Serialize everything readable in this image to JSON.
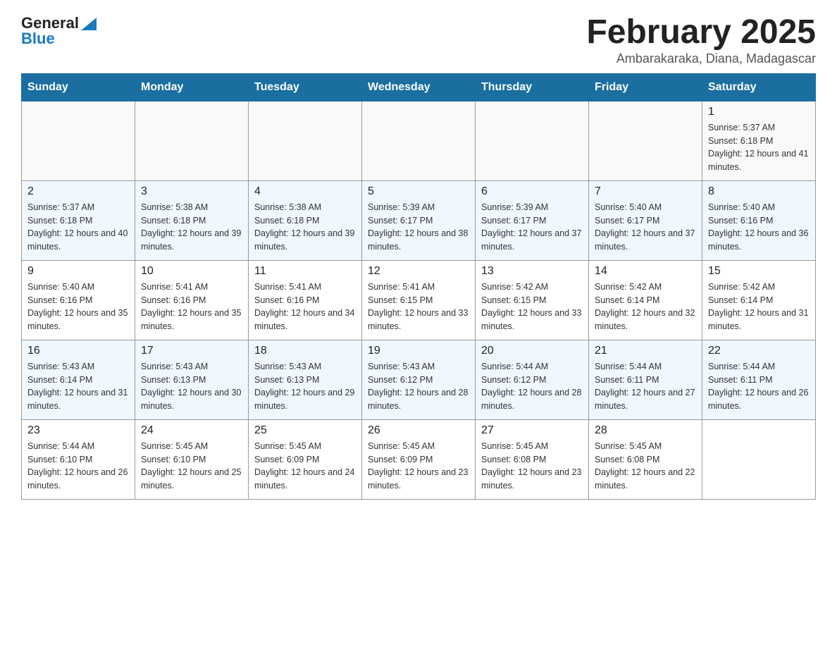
{
  "header": {
    "logo_general": "General",
    "logo_blue": "Blue",
    "title": "February 2025",
    "location": "Ambarakaraka, Diana, Madagascar"
  },
  "days_of_week": [
    "Sunday",
    "Monday",
    "Tuesday",
    "Wednesday",
    "Thursday",
    "Friday",
    "Saturday"
  ],
  "weeks": [
    {
      "days": [
        {
          "num": "",
          "info": ""
        },
        {
          "num": "",
          "info": ""
        },
        {
          "num": "",
          "info": ""
        },
        {
          "num": "",
          "info": ""
        },
        {
          "num": "",
          "info": ""
        },
        {
          "num": "",
          "info": ""
        },
        {
          "num": "1",
          "info": "Sunrise: 5:37 AM\nSunset: 6:18 PM\nDaylight: 12 hours and 41 minutes."
        }
      ]
    },
    {
      "days": [
        {
          "num": "2",
          "info": "Sunrise: 5:37 AM\nSunset: 6:18 PM\nDaylight: 12 hours and 40 minutes."
        },
        {
          "num": "3",
          "info": "Sunrise: 5:38 AM\nSunset: 6:18 PM\nDaylight: 12 hours and 39 minutes."
        },
        {
          "num": "4",
          "info": "Sunrise: 5:38 AM\nSunset: 6:18 PM\nDaylight: 12 hours and 39 minutes."
        },
        {
          "num": "5",
          "info": "Sunrise: 5:39 AM\nSunset: 6:17 PM\nDaylight: 12 hours and 38 minutes."
        },
        {
          "num": "6",
          "info": "Sunrise: 5:39 AM\nSunset: 6:17 PM\nDaylight: 12 hours and 37 minutes."
        },
        {
          "num": "7",
          "info": "Sunrise: 5:40 AM\nSunset: 6:17 PM\nDaylight: 12 hours and 37 minutes."
        },
        {
          "num": "8",
          "info": "Sunrise: 5:40 AM\nSunset: 6:16 PM\nDaylight: 12 hours and 36 minutes."
        }
      ]
    },
    {
      "days": [
        {
          "num": "9",
          "info": "Sunrise: 5:40 AM\nSunset: 6:16 PM\nDaylight: 12 hours and 35 minutes."
        },
        {
          "num": "10",
          "info": "Sunrise: 5:41 AM\nSunset: 6:16 PM\nDaylight: 12 hours and 35 minutes."
        },
        {
          "num": "11",
          "info": "Sunrise: 5:41 AM\nSunset: 6:16 PM\nDaylight: 12 hours and 34 minutes."
        },
        {
          "num": "12",
          "info": "Sunrise: 5:41 AM\nSunset: 6:15 PM\nDaylight: 12 hours and 33 minutes."
        },
        {
          "num": "13",
          "info": "Sunrise: 5:42 AM\nSunset: 6:15 PM\nDaylight: 12 hours and 33 minutes."
        },
        {
          "num": "14",
          "info": "Sunrise: 5:42 AM\nSunset: 6:14 PM\nDaylight: 12 hours and 32 minutes."
        },
        {
          "num": "15",
          "info": "Sunrise: 5:42 AM\nSunset: 6:14 PM\nDaylight: 12 hours and 31 minutes."
        }
      ]
    },
    {
      "days": [
        {
          "num": "16",
          "info": "Sunrise: 5:43 AM\nSunset: 6:14 PM\nDaylight: 12 hours and 31 minutes."
        },
        {
          "num": "17",
          "info": "Sunrise: 5:43 AM\nSunset: 6:13 PM\nDaylight: 12 hours and 30 minutes."
        },
        {
          "num": "18",
          "info": "Sunrise: 5:43 AM\nSunset: 6:13 PM\nDaylight: 12 hours and 29 minutes."
        },
        {
          "num": "19",
          "info": "Sunrise: 5:43 AM\nSunset: 6:12 PM\nDaylight: 12 hours and 28 minutes."
        },
        {
          "num": "20",
          "info": "Sunrise: 5:44 AM\nSunset: 6:12 PM\nDaylight: 12 hours and 28 minutes."
        },
        {
          "num": "21",
          "info": "Sunrise: 5:44 AM\nSunset: 6:11 PM\nDaylight: 12 hours and 27 minutes."
        },
        {
          "num": "22",
          "info": "Sunrise: 5:44 AM\nSunset: 6:11 PM\nDaylight: 12 hours and 26 minutes."
        }
      ]
    },
    {
      "days": [
        {
          "num": "23",
          "info": "Sunrise: 5:44 AM\nSunset: 6:10 PM\nDaylight: 12 hours and 26 minutes."
        },
        {
          "num": "24",
          "info": "Sunrise: 5:45 AM\nSunset: 6:10 PM\nDaylight: 12 hours and 25 minutes."
        },
        {
          "num": "25",
          "info": "Sunrise: 5:45 AM\nSunset: 6:09 PM\nDaylight: 12 hours and 24 minutes."
        },
        {
          "num": "26",
          "info": "Sunrise: 5:45 AM\nSunset: 6:09 PM\nDaylight: 12 hours and 23 minutes."
        },
        {
          "num": "27",
          "info": "Sunrise: 5:45 AM\nSunset: 6:08 PM\nDaylight: 12 hours and 23 minutes."
        },
        {
          "num": "28",
          "info": "Sunrise: 5:45 AM\nSunset: 6:08 PM\nDaylight: 12 hours and 22 minutes."
        },
        {
          "num": "",
          "info": ""
        }
      ]
    }
  ]
}
